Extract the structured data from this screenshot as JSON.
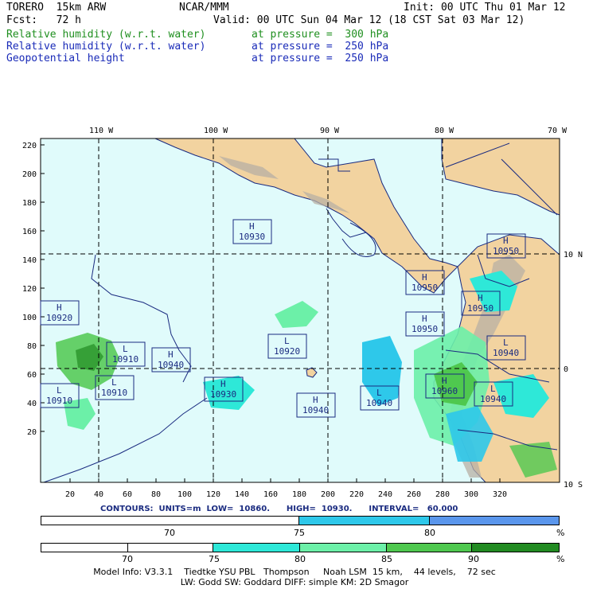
{
  "header": {
    "model": "TORERO  15km ARW",
    "center": "NCAR/MMM",
    "init": "Init: 00 UTC Thu 01 Mar 12",
    "fcst": "Fcst:   72 h",
    "valid": "Valid: 00 UTC Sun 04 Mar 12 (18 CST Sat 03 Mar 12)",
    "fields": [
      {
        "name": "Relative humidity (w.r.t. water)",
        "level": "at pressure =  300 hPa",
        "color": "#1f8f1f"
      },
      {
        "name": "Relative humidity (w.r.t. water)",
        "level": "at pressure =  250 hPa",
        "color": "#1a2bb8"
      },
      {
        "name": "Geopotential height",
        "level": "at pressure =  250 hPa",
        "color": "#1a2bb8"
      }
    ]
  },
  "map": {
    "lon_labels": [
      "110 W",
      "100 W",
      "90 W",
      "80 W",
      "70 W"
    ],
    "lat_labels": [
      "10 N",
      "0",
      "10 S"
    ],
    "y_ticks": [
      "220",
      "200",
      "180",
      "160",
      "140",
      "120",
      "100",
      "80",
      "60",
      "40",
      "20"
    ],
    "x_ticks": [
      "20",
      "40",
      "60",
      "80",
      "100",
      "120",
      "140",
      "160",
      "180",
      "200",
      "220",
      "240",
      "260",
      "280",
      "300",
      "320"
    ],
    "ocean_color": "#e0fbfb",
    "land_color": "#f2d3a0",
    "centers": [
      {
        "type": "H",
        "value": "10930"
      },
      {
        "type": "H",
        "value": "10950"
      },
      {
        "type": "H",
        "value": "10950"
      },
      {
        "type": "H",
        "value": "10950"
      },
      {
        "type": "H",
        "value": "10920"
      },
      {
        "type": "H",
        "value": "10950"
      },
      {
        "type": "L",
        "value": "10910"
      },
      {
        "type": "H",
        "value": "10940"
      },
      {
        "type": "L",
        "value": "10920"
      },
      {
        "type": "L",
        "value": "10940"
      },
      {
        "type": "L",
        "value": "10910"
      },
      {
        "type": "L",
        "value": "10910"
      },
      {
        "type": "H",
        "value": "10930"
      },
      {
        "type": "H",
        "value": "10940"
      },
      {
        "type": "L",
        "value": "10940"
      },
      {
        "type": "H",
        "value": "10960"
      },
      {
        "type": "L",
        "value": "10940"
      }
    ]
  },
  "contours": "CONTOURS:  UNITS=m  LOW=  10860.      HIGH=  10930.      INTERVAL=   60.000",
  "colorbar1": {
    "labels": [
      "70",
      "75",
      "80"
    ],
    "unit": "%",
    "colors": [
      "#ffffff",
      "#2ec8ea",
      "#5a96ec"
    ]
  },
  "colorbar2": {
    "labels": [
      "70",
      "75",
      "80",
      "85",
      "90"
    ],
    "unit": "%",
    "colors": [
      "#ffffff",
      "#ffffff",
      "#2ee8d8",
      "#6cf0a8",
      "#4fc84f",
      "#228b22"
    ]
  },
  "footer": {
    "line1": "Model Info: V3.3.1    Tiedtke YSU PBL   Thompson     Noah LSM  15 km,    44 levels,    72 sec",
    "line2": "LW: Godd SW: Goddard DIFF: simple KM: 2D Smagor"
  }
}
